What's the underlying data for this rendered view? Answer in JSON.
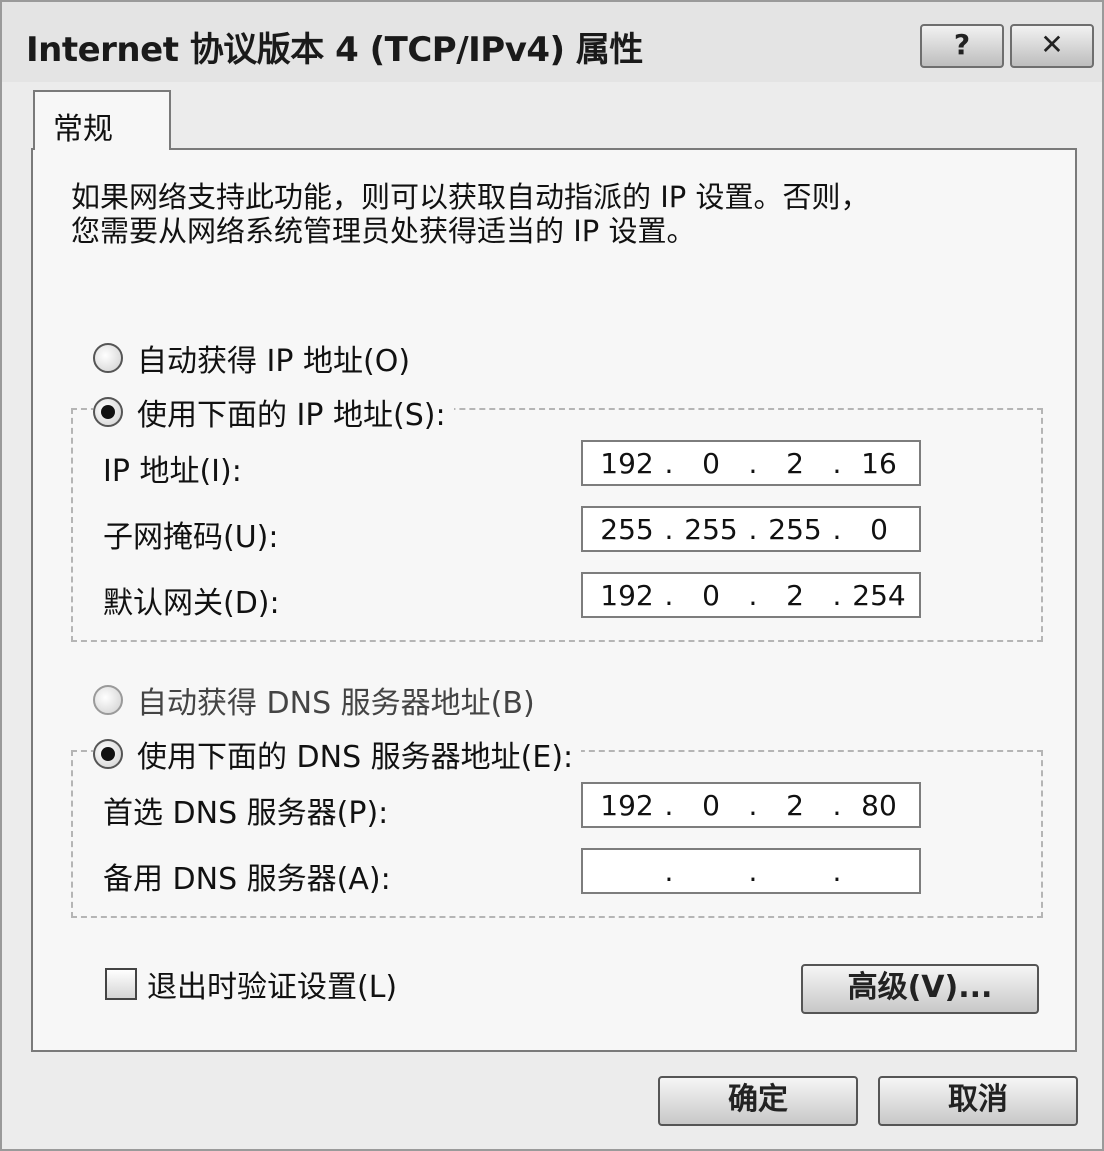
{
  "window": {
    "title": "Internet 协议版本 4 (TCP/IPv4) 属性",
    "help_label": "?",
    "close_label": "✕"
  },
  "tabs": [
    {
      "label": "常规"
    }
  ],
  "description": {
    "line1": "如果网络支持此功能，则可以获取自动指派的 IP 设置。否则，",
    "line2": "您需要从网络系统管理员处获得适当的 IP 设置。"
  },
  "ip_section": {
    "auto_label": "自动获得 IP 地址(O)",
    "manual_label": "使用下面的 IP 地址(S):",
    "selected": "manual",
    "fields": [
      {
        "label": "IP 地址(I):",
        "octets": [
          "192",
          "0",
          "2",
          "16"
        ]
      },
      {
        "label": "子网掩码(U):",
        "octets": [
          "255",
          "255",
          "255",
          "0"
        ]
      },
      {
        "label": "默认网关(D):",
        "octets": [
          "192",
          "0",
          "2",
          "254"
        ]
      }
    ]
  },
  "dns_section": {
    "auto_label": "自动获得 DNS 服务器地址(B)",
    "manual_label": "使用下面的 DNS 服务器地址(E):",
    "selected": "manual",
    "fields": [
      {
        "label": "首选 DNS 服务器(P):",
        "octets": [
          "192",
          "0",
          "2",
          "80"
        ]
      },
      {
        "label": "备用 DNS 服务器(A):",
        "octets": [
          "",
          "",
          "",
          ""
        ]
      }
    ]
  },
  "validate_label": "退出时验证设置(L)",
  "validate_checked": false,
  "buttons": {
    "advanced": "高级(V)...",
    "ok": "确定",
    "cancel": "取消"
  }
}
